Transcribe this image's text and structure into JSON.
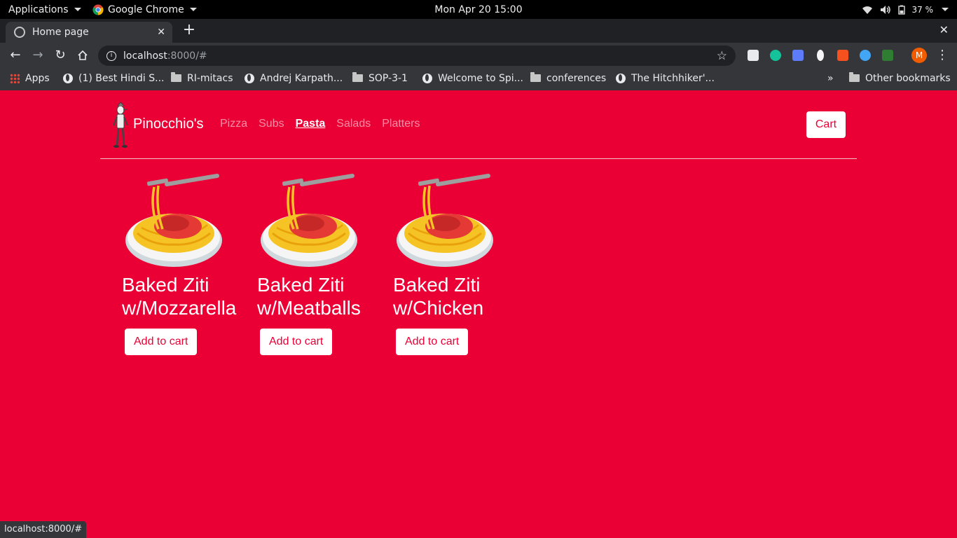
{
  "topbar": {
    "applications_label": "Applications",
    "browser_label": "Google Chrome",
    "clock": "Mon Apr 20  15:00",
    "battery": "37 %"
  },
  "tab": {
    "title": "Home page"
  },
  "omnibox": {
    "host": "localhost",
    "path": ":8000/#"
  },
  "bookmarks": {
    "apps": "Apps",
    "items": [
      "(1) Best Hindi S...",
      "RI-mitacs",
      "Andrej Karpath...",
      "SOP-3-1",
      "Welcome to Spi...",
      "conferences",
      "The Hitchhiker'..."
    ],
    "overflow": "»",
    "other": "Other bookmarks"
  },
  "site": {
    "brand": "Pinocchio's",
    "nav": [
      "Pizza",
      "Subs",
      "Pasta",
      "Salads",
      "Platters"
    ],
    "cart_label": "Cart",
    "products": [
      {
        "line1": "Baked Ziti",
        "line2": "w/Mozzarella",
        "button": "Add to cart"
      },
      {
        "line1": "Baked Ziti",
        "line2": "w/Meatballs",
        "button": "Add to cart"
      },
      {
        "line1": "Baked Ziti",
        "line2": "w/Chicken",
        "button": "Add to cart"
      }
    ]
  },
  "statusbar": {
    "text": "localhost:8000/#"
  },
  "colors": {
    "brand_red": "#ea0034",
    "chrome_dark": "#35363a",
    "profile_orange": "#f25c00"
  }
}
